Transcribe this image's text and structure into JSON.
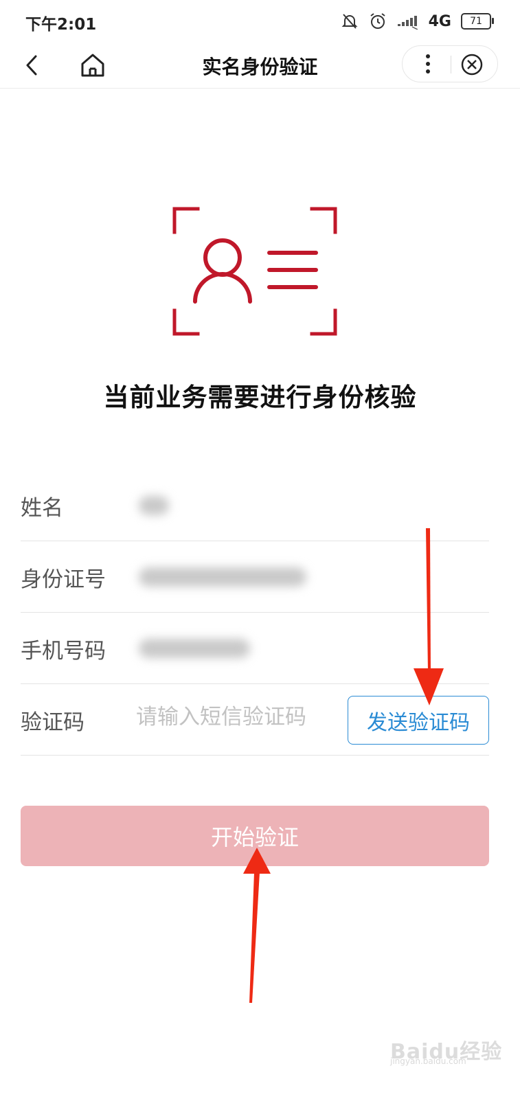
{
  "status_bar": {
    "time": "下午2:01",
    "network": "4G",
    "battery": "71",
    "icons": [
      "bell-off-icon",
      "alarm-icon",
      "signal-icon",
      "battery-icon"
    ]
  },
  "nav": {
    "title": "实名身份验证",
    "icons": [
      "back-icon",
      "home-icon",
      "more-icon",
      "close-icon"
    ]
  },
  "hero": {
    "icon": "id-card-person-icon",
    "headline": "当前业务需要进行身份核验"
  },
  "form": {
    "rows": [
      {
        "label": "姓名",
        "value_obscured": true
      },
      {
        "label": "身份证号",
        "value_obscured": true
      },
      {
        "label": "手机号码",
        "value_obscured": true
      },
      {
        "label": "验证码",
        "placeholder": "请输入短信验证码",
        "value": ""
      }
    ],
    "send_code_button": "发送验证码",
    "submit_button": "开始验证"
  },
  "watermark": {
    "text": "Baidu经验",
    "sub": "jingyan.baidu.com"
  },
  "colors": {
    "accent_red": "#c0182a",
    "button_disabled": "#edb3b7",
    "link_blue": "#2a8bd4",
    "annotation_arrow": "#ee2a14"
  }
}
